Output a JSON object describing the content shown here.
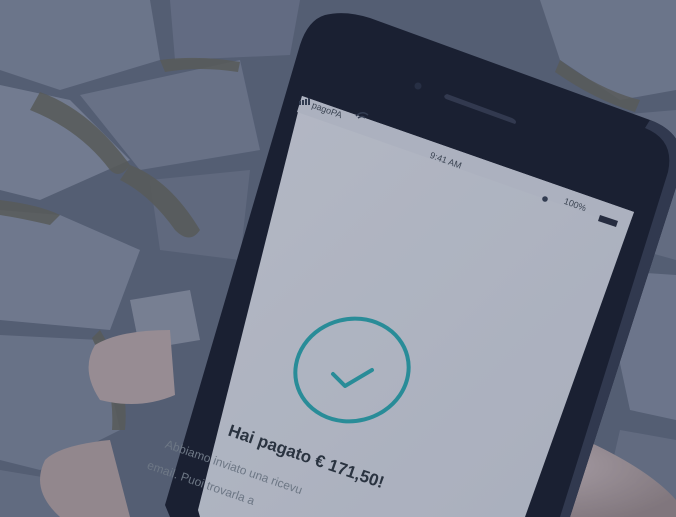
{
  "status_bar": {
    "carrier": "pagoPA",
    "time": "9:41 AM",
    "battery": "100%"
  },
  "success": {
    "title": "Hai pagato € 171,50!",
    "body_line1": "Abbiamo inviato una ricevu",
    "body_line2": "email. Puoi trovarla a"
  },
  "colors": {
    "accent": "#2fb3b4",
    "phone_body": "#1a1e28",
    "screen": "#e9ecef"
  }
}
